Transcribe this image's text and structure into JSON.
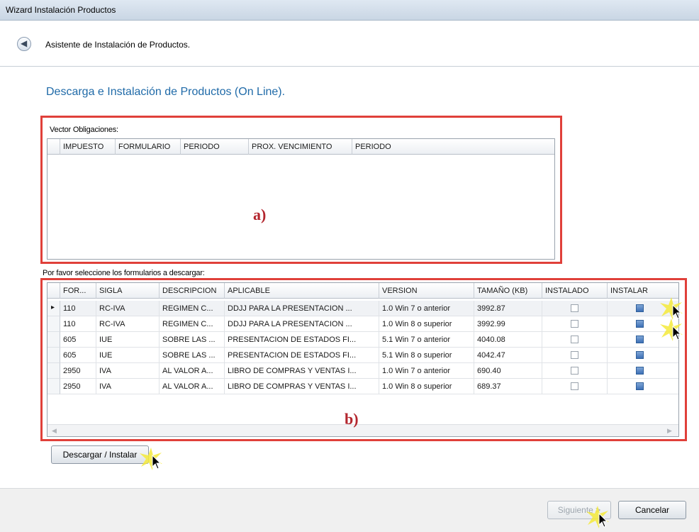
{
  "window": {
    "title": "Wizard Instalación Productos"
  },
  "header": {
    "back_icon": "back-arrow-icon",
    "text": "Asistente de Instalación de Productos."
  },
  "page": {
    "title": "Descarga e Instalación de Productos (On Line)."
  },
  "obligations": {
    "label": "Vector Obligaciones:",
    "columns": [
      "IMPUESTO",
      "FORMULARIO",
      "PERIODO",
      "PROX. VENCIMIENTO",
      "PERIODO"
    ],
    "annotation": "a)"
  },
  "forms": {
    "label": "Por favor seleccione los formularios a descargar:",
    "columns": [
      "FOR...",
      "SIGLA",
      "DESCRIPCION",
      "APLICABLE",
      "VERSION",
      "TAMAÑO (KB)",
      "INSTALADO",
      "INSTALAR"
    ],
    "rows": [
      {
        "form": "110",
        "sigla": "RC-IVA",
        "descripcion": "REGIMEN C...",
        "aplicable": "DDJJ PARA LA PRESENTACION ...",
        "version": "1.0 Win 7 o anterior",
        "size": "3992.87",
        "installed": false,
        "install": true,
        "current": true
      },
      {
        "form": "110",
        "sigla": "RC-IVA",
        "descripcion": "REGIMEN C...",
        "aplicable": "DDJJ PARA LA PRESENTACION ...",
        "version": "1.0 Win 8 o superior",
        "size": "3992.99",
        "installed": false,
        "install": true,
        "current": false
      },
      {
        "form": "605",
        "sigla": "IUE",
        "descripcion": "SOBRE LAS ...",
        "aplicable": "PRESENTACION DE ESTADOS FI...",
        "version": "5.1 Win 7 o anterior",
        "size": "4040.08",
        "installed": false,
        "install": true,
        "current": false
      },
      {
        "form": "605",
        "sigla": "IUE",
        "descripcion": "SOBRE LAS ...",
        "aplicable": "PRESENTACION DE ESTADOS FI...",
        "version": "5.1 Win 8 o superior",
        "size": "4042.47",
        "installed": false,
        "install": true,
        "current": false
      },
      {
        "form": "2950",
        "sigla": "IVA",
        "descripcion": "AL VALOR A...",
        "aplicable": "LIBRO DE COMPRAS Y VENTAS I...",
        "version": "1.0 Win 7 o anterior",
        "size": "690.40",
        "installed": false,
        "install": true,
        "current": false
      },
      {
        "form": "2950",
        "sigla": "IVA",
        "descripcion": "AL VALOR A...",
        "aplicable": "LIBRO DE COMPRAS Y VENTAS I...",
        "version": "1.0 Win 8 o superior",
        "size": "689.37",
        "installed": false,
        "install": true,
        "current": false
      }
    ],
    "annotation": "b)"
  },
  "buttons": {
    "download": "Descargar / Instalar",
    "next": "Siguiente >",
    "cancel": "Cancelar"
  },
  "colors": {
    "accent": "#1f6aa8",
    "highlight_box": "#e0403a",
    "annotation": "#b3262e"
  }
}
